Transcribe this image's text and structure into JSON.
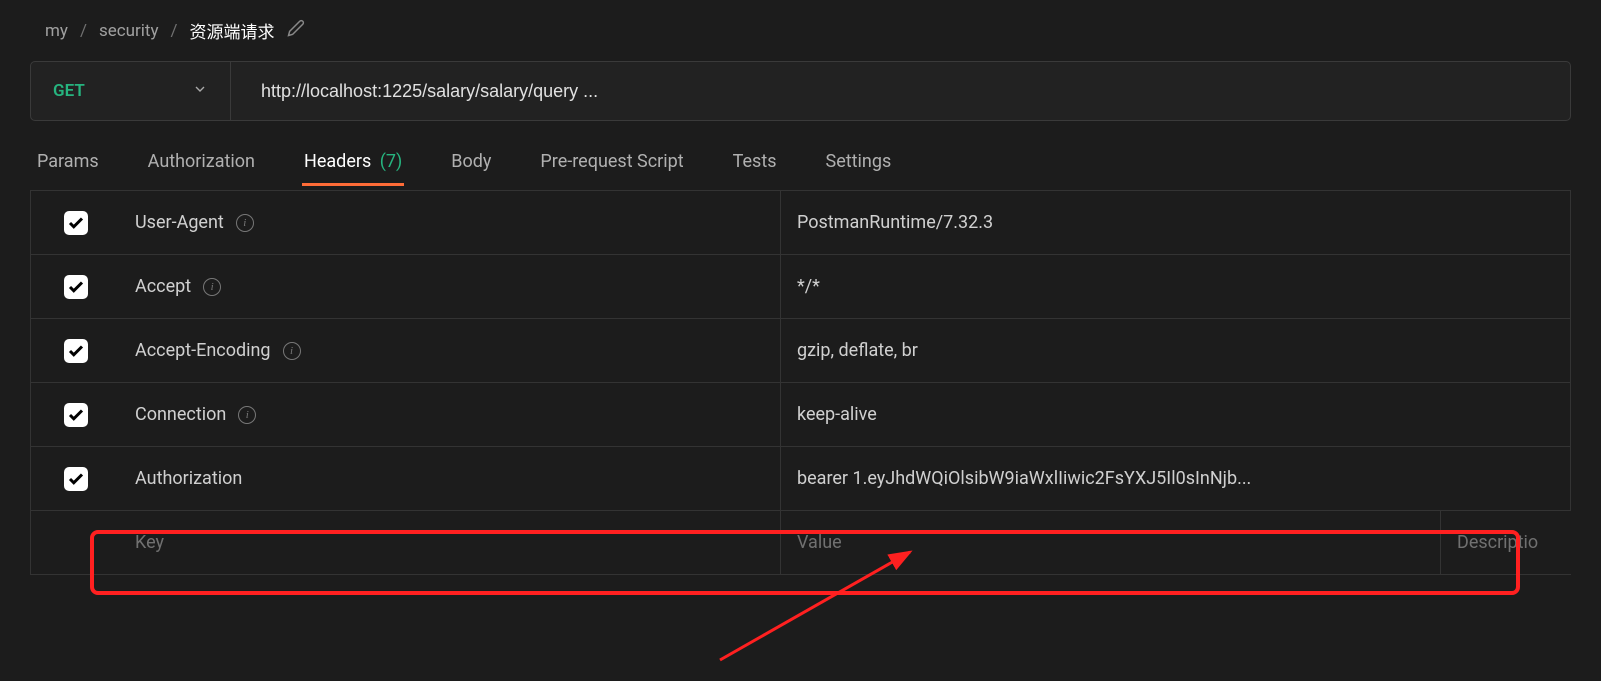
{
  "breadcrumb": {
    "items": [
      "my",
      "security",
      "资源端请求"
    ]
  },
  "request": {
    "method": "GET",
    "url": "http://localhost:1225/salary/salary/query ..."
  },
  "tabs": {
    "params": "Params",
    "auth": "Authorization",
    "headers_label": "Headers",
    "headers_count": "(7)",
    "body": "Body",
    "prereq": "Pre-request Script",
    "tests": "Tests",
    "settings": "Settings"
  },
  "headers": {
    "rows": [
      {
        "key": "User-Agent",
        "value": "PostmanRuntime/7.32.3",
        "info": true,
        "checked": true
      },
      {
        "key": "Accept",
        "value": "*/*",
        "info": true,
        "checked": true
      },
      {
        "key": "Accept-Encoding",
        "value": "gzip, deflate, br",
        "info": true,
        "checked": true
      },
      {
        "key": "Connection",
        "value": "keep-alive",
        "info": true,
        "checked": true
      },
      {
        "key": "Authorization",
        "value": "bearer 1.eyJhdWQiOlsibW9iaWxlIiwic2FsYXJ5Il0sInNjb...",
        "info": false,
        "checked": true
      }
    ],
    "placeholder": {
      "key": "Key",
      "value": "Value",
      "desc": "Descriptio"
    }
  }
}
